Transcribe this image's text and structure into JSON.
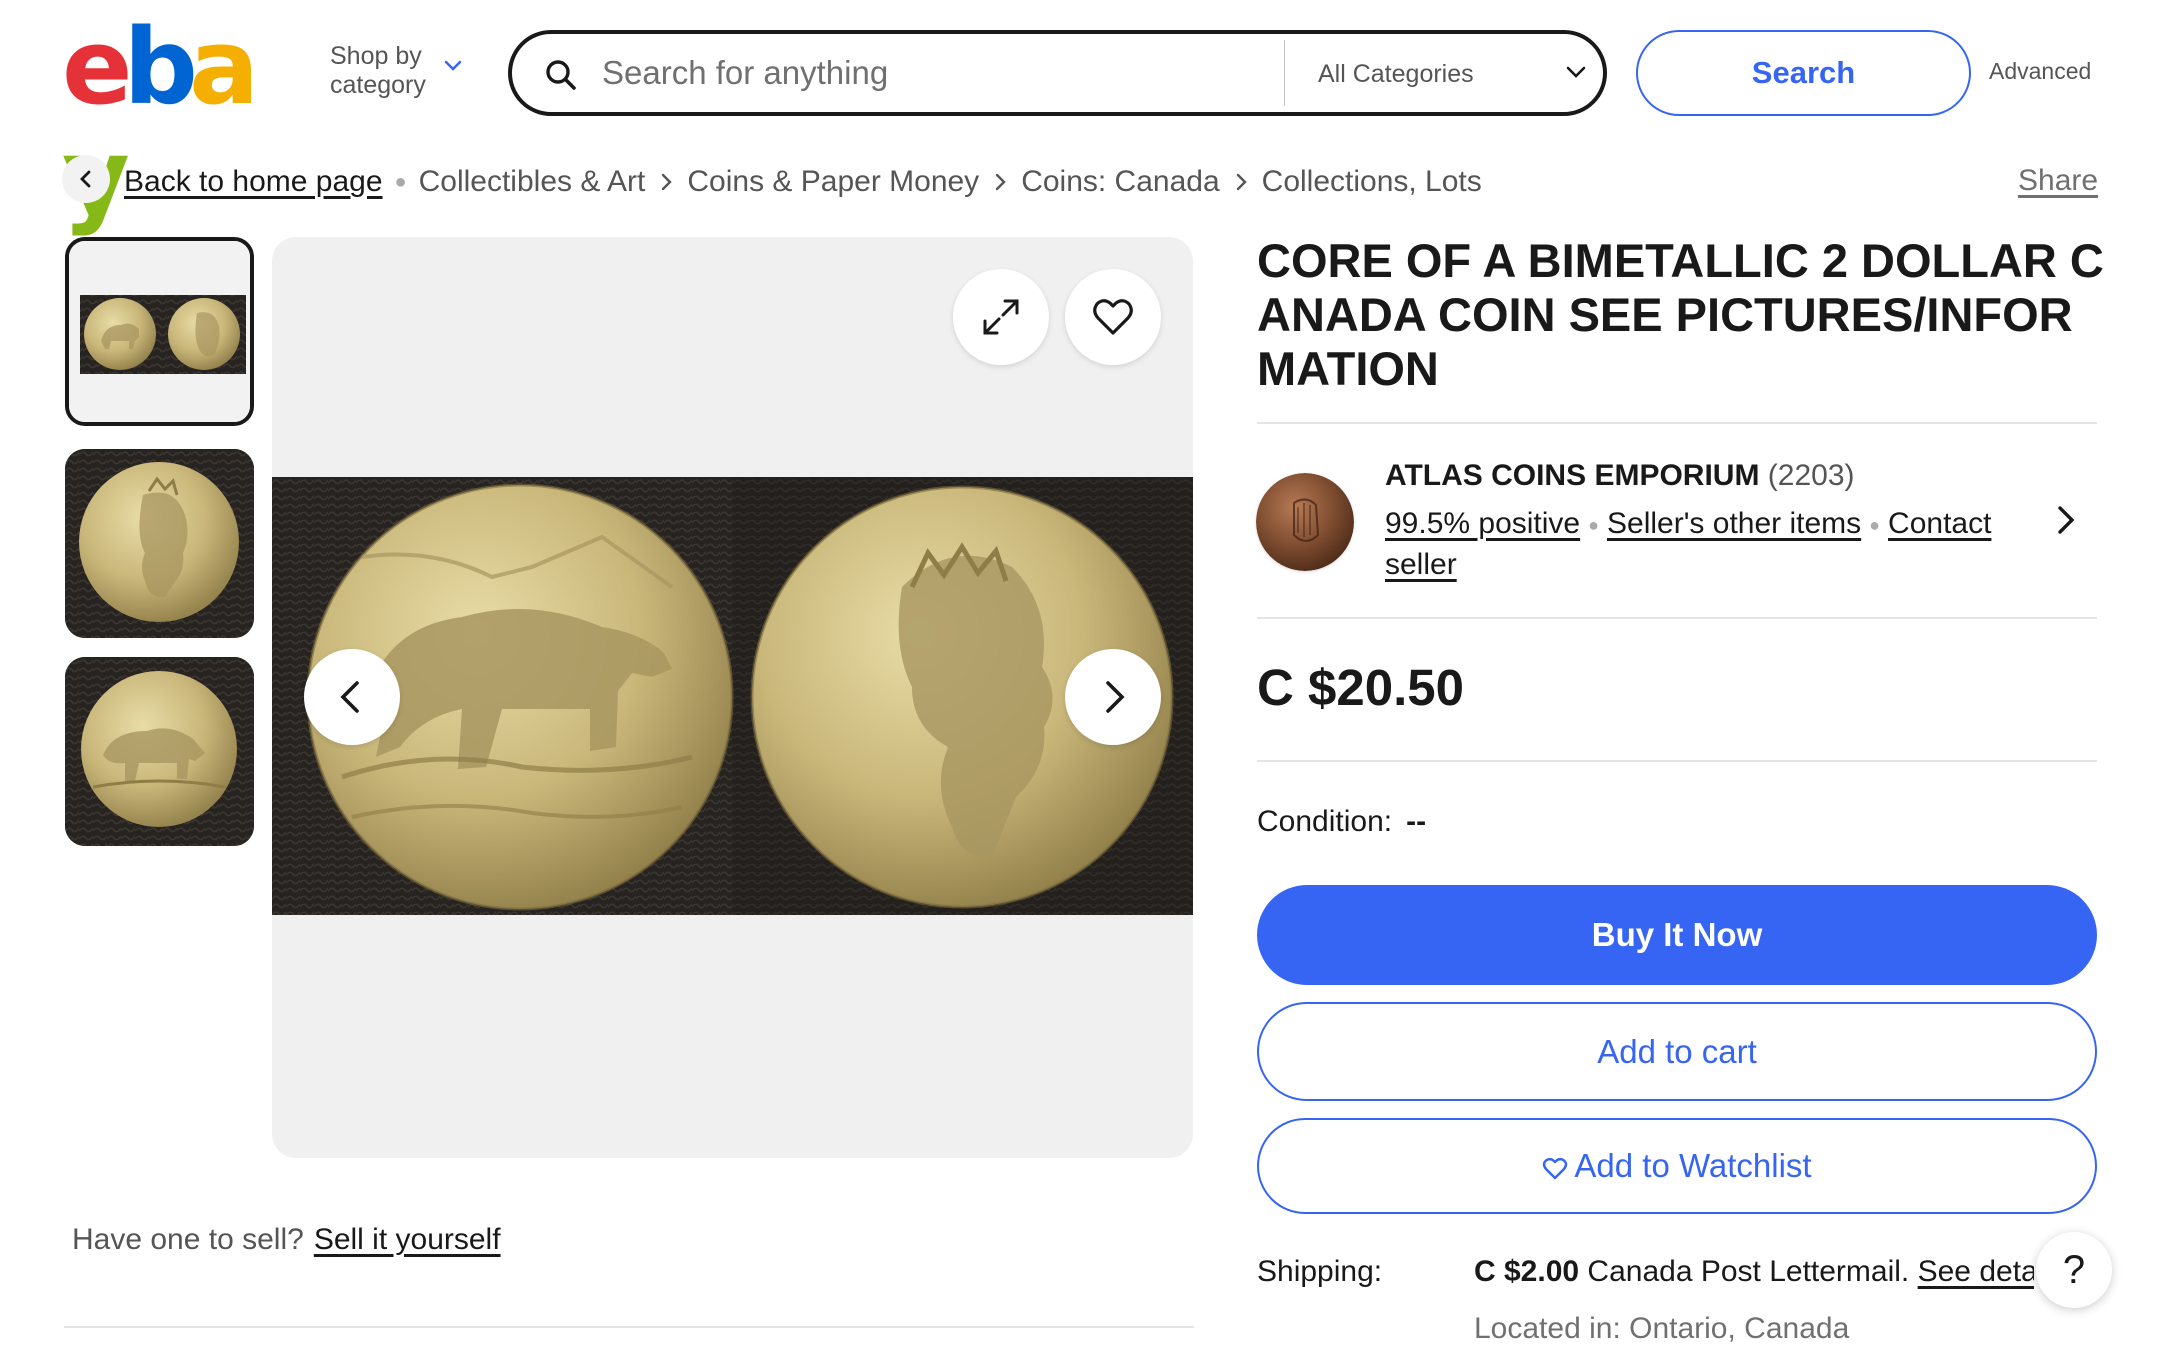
{
  "header": {
    "logo": [
      "e",
      "b",
      "a",
      "y"
    ],
    "logo_colors": [
      "#e53238",
      "#0064d2",
      "#f5af02",
      "#86b817"
    ],
    "shop_by_line1": "Shop by",
    "shop_by_line2": "category",
    "search_placeholder": "Search for anything",
    "category": "All Categories",
    "search_button": "Search",
    "advanced": "Advanced"
  },
  "breadcrumb": {
    "back": "Back to home page",
    "items": [
      "Collectibles & Art",
      "Coins & Paper Money",
      "Coins: Canada",
      "Collections, Lots"
    ],
    "share": "Share"
  },
  "gallery": {
    "thumbnails": [
      "both-sides",
      "queen-side",
      "bear-side"
    ],
    "selected": 0
  },
  "listing": {
    "title": "CORE OF A BIMETALLIC 2 DOLLAR CANADA COIN SEE PICTURES/INFORMATION",
    "seller": {
      "name": "ATLAS COINS EMPORIUM",
      "feedback_count": "(2203)",
      "positive": "99.5% positive",
      "other_items": "Seller's other items",
      "contact": "Contact seller"
    },
    "price": "C $20.50",
    "condition_label": "Condition:",
    "condition_value": "--",
    "buy_now": "Buy It Now",
    "add_to_cart": "Add to cart",
    "add_to_watchlist": "Add to Watchlist",
    "shipping_label": "Shipping:",
    "shipping_price": "C $2.00",
    "shipping_method": "Canada Post Lettermail.",
    "shipping_details": "See details",
    "located": "Located in: Ontario, Canada"
  },
  "sell": {
    "prompt": "Have one to sell?",
    "link": "Sell it yourself"
  },
  "help": "?",
  "colors": {
    "accent": "#3665f3",
    "text": "#191919",
    "muted": "#707070",
    "panel": "#f0f0f0"
  }
}
